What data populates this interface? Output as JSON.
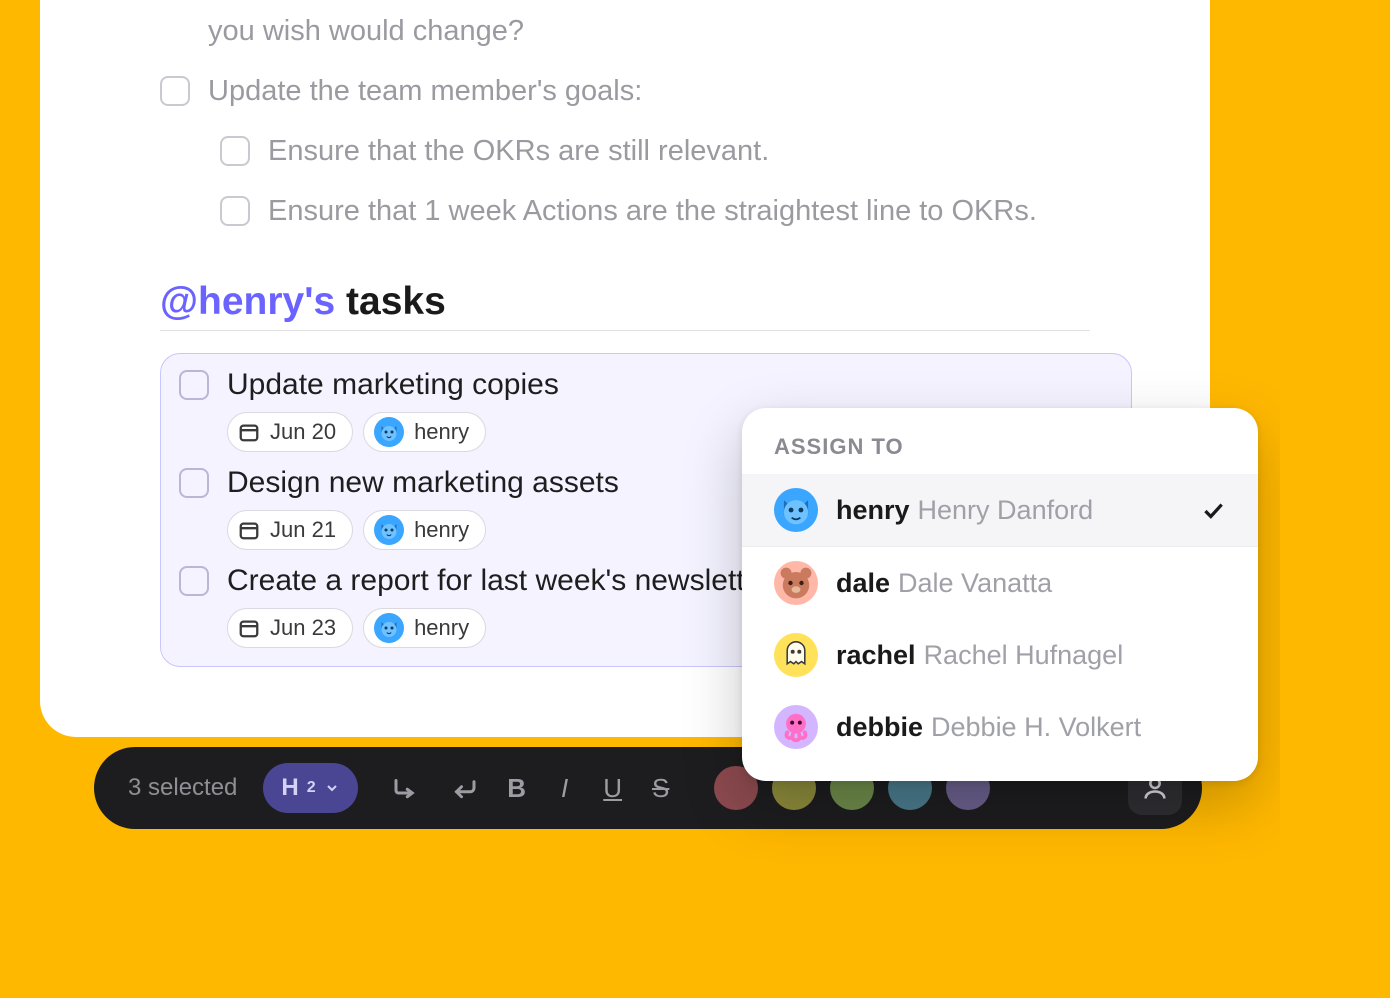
{
  "doc": {
    "previous_line": "you wish would change?",
    "update_goals": "Update the team member's goals:",
    "sub_items": [
      "Ensure that the OKRs are still relevant.",
      "Ensure that 1 week Actions are the straightest line to OKRs."
    ],
    "mention": "@henry's",
    "title_suffix": " tasks"
  },
  "tasks": [
    {
      "title": "Update marketing copies",
      "date": "Jun 20",
      "assignee": "henry"
    },
    {
      "title": "Design new marketing assets",
      "date": "Jun 21",
      "assignee": "henry"
    },
    {
      "title": "Create a report for last week's newsletter",
      "date": "Jun 23",
      "assignee": "henry"
    }
  ],
  "popup": {
    "title": "ASSIGN TO",
    "items": [
      {
        "username": "henry",
        "fullname": "Henry Danford",
        "selected": true,
        "avatar": "fox"
      },
      {
        "username": "dale",
        "fullname": "Dale Vanatta",
        "selected": false,
        "avatar": "bear"
      },
      {
        "username": "rachel",
        "fullname": "Rachel Hufnagel",
        "selected": false,
        "avatar": "ghost"
      },
      {
        "username": "debbie",
        "fullname": "Debbie H. Volkert",
        "selected": false,
        "avatar": "octopus"
      }
    ]
  },
  "toolbar": {
    "selected_text": "3 selected",
    "heading_label": "H",
    "heading_sub": "2",
    "bold": "B",
    "italic": "I",
    "underline": "U",
    "strike": "S",
    "colors": [
      "#8c4a4f",
      "#8c8a3a",
      "#6d8a4a",
      "#4a7a8c",
      "#6a5f8c"
    ]
  }
}
